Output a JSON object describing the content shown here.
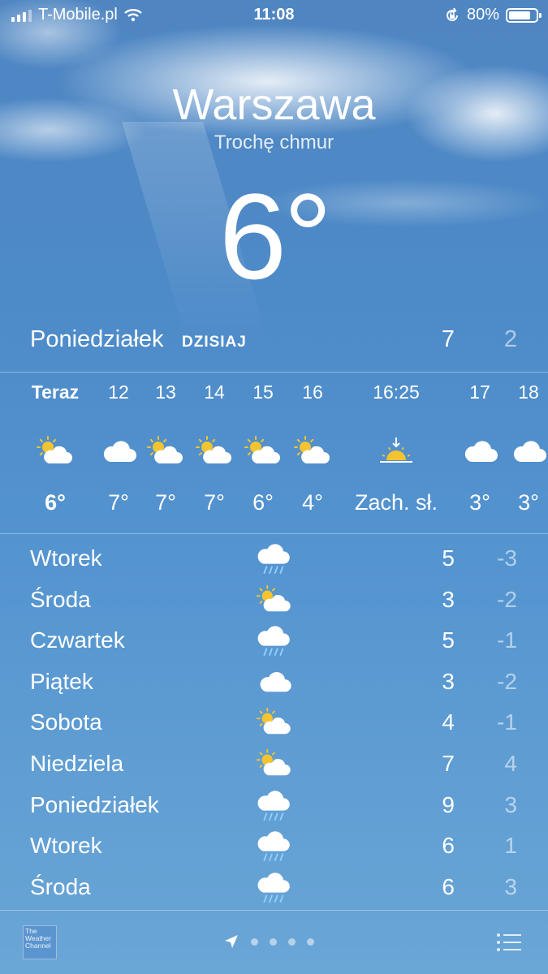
{
  "status": {
    "carrier": "T-Mobile.pl",
    "time": "11:08",
    "battery": "80%",
    "battery_level": 0.8
  },
  "location": {
    "city": "Warszawa",
    "condition": "Trochę chmur",
    "temp": "6°"
  },
  "today": {
    "day": "Poniedziałek",
    "tag": "DZISIAJ",
    "high": "7",
    "low": "2"
  },
  "hourly": [
    {
      "time": "Teraz",
      "icon": "sun-cloud-icon",
      "temp": "6°"
    },
    {
      "time": "12",
      "icon": "cloud-icon",
      "temp": "7°"
    },
    {
      "time": "13",
      "icon": "sun-cloud-icon",
      "temp": "7°"
    },
    {
      "time": "14",
      "icon": "sun-cloud-icon",
      "temp": "7°"
    },
    {
      "time": "15",
      "icon": "sun-cloud-icon",
      "temp": "6°"
    },
    {
      "time": "16",
      "icon": "sun-cloud-icon",
      "temp": "4°"
    },
    {
      "time": "16:25",
      "icon": "sunset-icon",
      "temp": "Zach. sł."
    },
    {
      "time": "17",
      "icon": "cloud-icon",
      "temp": "3°"
    },
    {
      "time": "18",
      "icon": "cloud-icon",
      "temp": "3°"
    }
  ],
  "daily": [
    {
      "day": "Wtorek",
      "icon": "rain-cloud-icon",
      "high": "5",
      "low": "-3"
    },
    {
      "day": "Środa",
      "icon": "sun-cloud-icon",
      "high": "3",
      "low": "-2"
    },
    {
      "day": "Czwartek",
      "icon": "rain-cloud-icon",
      "high": "5",
      "low": "-1"
    },
    {
      "day": "Piątek",
      "icon": "cloud-icon",
      "high": "3",
      "low": "-2"
    },
    {
      "day": "Sobota",
      "icon": "sun-cloud-icon",
      "high": "4",
      "low": "-1"
    },
    {
      "day": "Niedziela",
      "icon": "sun-cloud-icon",
      "high": "7",
      "low": "4"
    },
    {
      "day": "Poniedziałek",
      "icon": "rain-cloud-icon",
      "high": "9",
      "low": "3"
    },
    {
      "day": "Wtorek",
      "icon": "rain-cloud-icon",
      "high": "6",
      "low": "1"
    },
    {
      "day": "Środa",
      "icon": "rain-cloud-icon",
      "high": "6",
      "low": "3"
    }
  ],
  "footer": {
    "logo_text": "The Weather Channel",
    "page_count": 5
  },
  "colors": {
    "sky_top": "#4f86c2",
    "sky_bottom": "#6aa6d6",
    "sun": "#f4c430",
    "rain": "#8fd0ff"
  }
}
